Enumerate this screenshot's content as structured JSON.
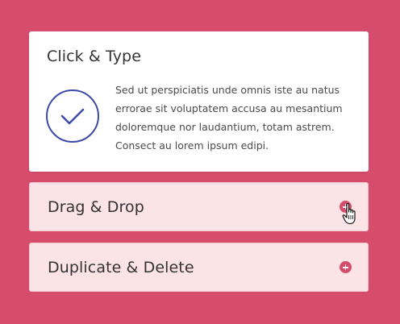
{
  "accordion": {
    "items": [
      {
        "title": "Click & Type",
        "expanded": true,
        "icon": "checkmark-circle-icon",
        "body_lines": [
          "Sed ut perspiciatis unde omnis iste au natus",
          "errorae sit voluptatem accusa au mesantium",
          "doloremque nor laudantium, totam astrem.",
          "Consect au lorem ipsum edipi."
        ]
      },
      {
        "title": "Drag & Drop",
        "expanded": false,
        "icon": "plus-circle-icon"
      },
      {
        "title": "Duplicate & Delete",
        "expanded": false,
        "icon": "plus-circle-icon"
      }
    ]
  },
  "colors": {
    "background": "#d64d6c",
    "accent": "#d64d6c",
    "check_icon": "#3e4aa8",
    "collapsed_panel": "#fbe3e6",
    "expanded_panel": "#ffffff"
  },
  "cursor": "hand-pointer-icon"
}
